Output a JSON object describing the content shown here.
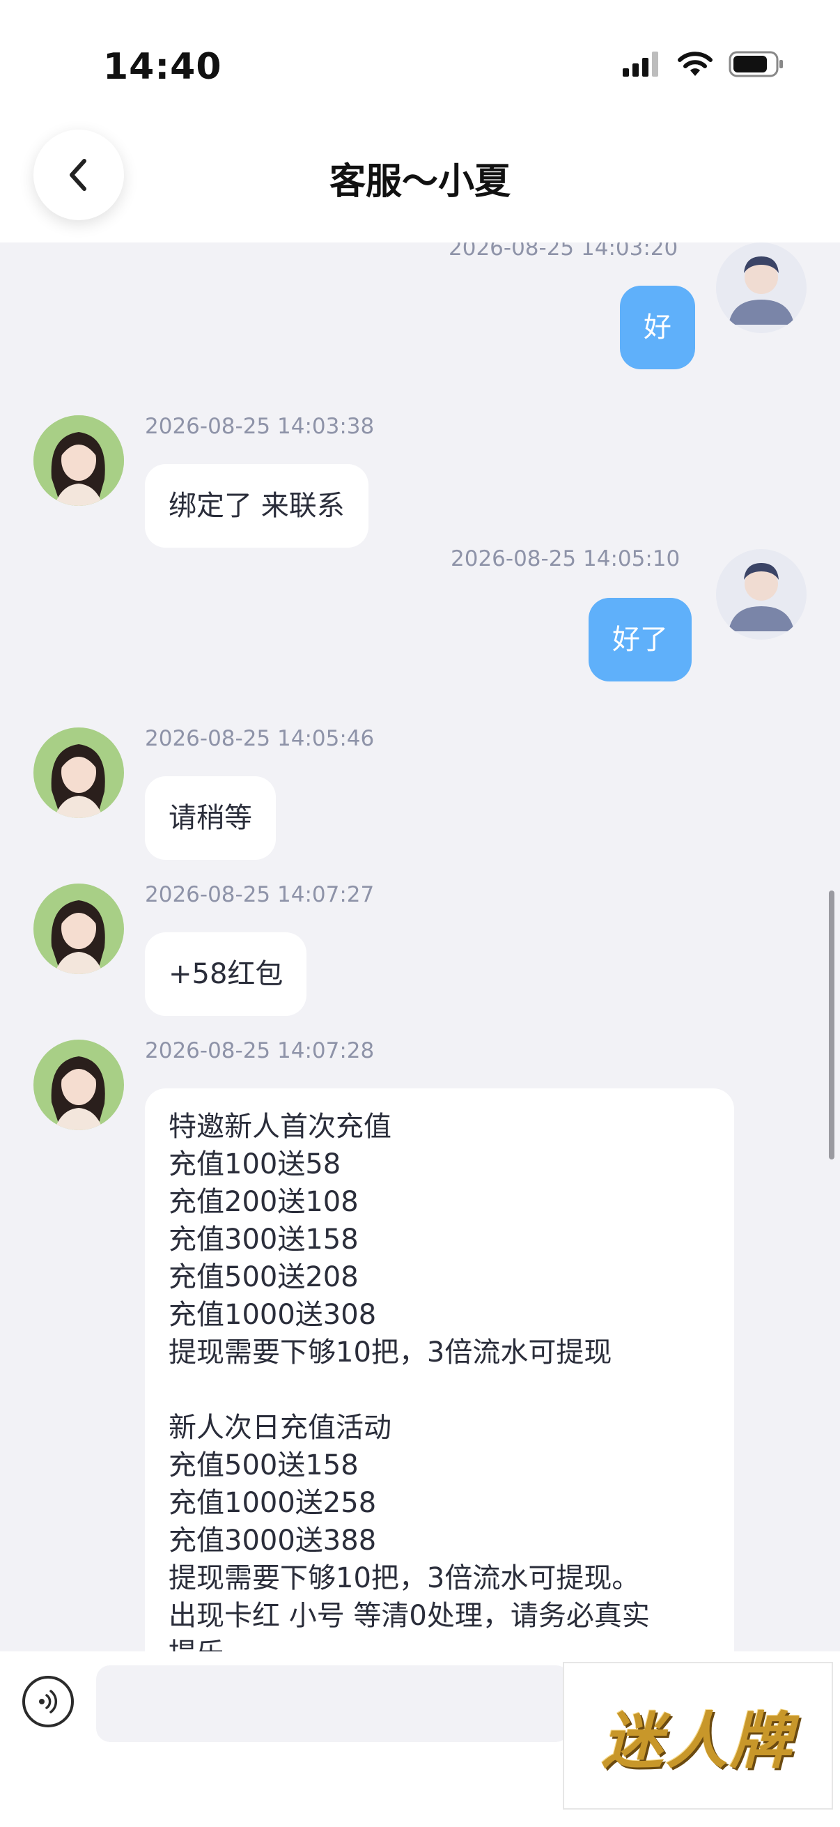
{
  "status_bar": {
    "time": "14:40"
  },
  "header": {
    "title": "客服～小夏"
  },
  "messages": [
    {
      "id": "m1",
      "side": "out",
      "timestamp": "2026-08-25 14:03:20",
      "text": "好"
    },
    {
      "id": "m2",
      "side": "in",
      "timestamp": "2026-08-25 14:03:38",
      "text": "绑定了 来联系"
    },
    {
      "id": "m3",
      "side": "out",
      "timestamp": "2026-08-25 14:05:10",
      "text": "好了"
    },
    {
      "id": "m4",
      "side": "in",
      "timestamp": "2026-08-25 14:05:46",
      "text": "请稍等"
    },
    {
      "id": "m5",
      "side": "in",
      "timestamp": "2026-08-25 14:07:27",
      "text": "+58红包"
    },
    {
      "id": "m6",
      "side": "in",
      "timestamp": "2026-08-25 14:07:28",
      "text": "特邀新人首次充值\n充值100送58\n充值200送108\n充值300送158\n充值500送208\n充值1000送308\n提现需要下够10把，3倍流水可提现\n\n新人次日充值活动\n充值500送158\n充值1000送258\n充值3000送388\n提现需要下够10把，3倍流水可提现。\n出现卡红 小号 等清0处理，请务必真实\n提乐"
    }
  ],
  "input": {
    "placeholder": ""
  },
  "logo": {
    "text": "迷人牌"
  },
  "colors": {
    "accent": "#5fb0fa",
    "background": "#f2f2f6"
  }
}
